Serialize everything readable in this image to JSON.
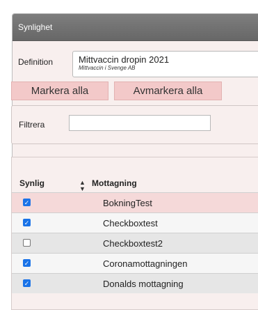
{
  "panel": {
    "title": "Synlighet"
  },
  "definition": {
    "label": "Definition",
    "selected_name": "Mittvaccin dropin 2021",
    "selected_org": "Mittvaccin i Svenge AB"
  },
  "buttons": {
    "select_all": "Markera alla",
    "deselect_all": "Avmarkera alla"
  },
  "filter": {
    "label": "Filtrera",
    "value": ""
  },
  "table": {
    "columns": {
      "visible": "Synlig",
      "reception": "Mottagning"
    },
    "rows": [
      {
        "checked": true,
        "name": "BokningTest",
        "bg": "#f5d9d9"
      },
      {
        "checked": true,
        "name": "Checkboxtest",
        "bg": "#f6f6f6"
      },
      {
        "checked": false,
        "name": "Checkboxtest2",
        "bg": "#e6e6e6"
      },
      {
        "checked": true,
        "name": "Coronamottagningen",
        "bg": "#f6f6f6"
      },
      {
        "checked": true,
        "name": "Donalds mottagning",
        "bg": "#e6e6e6"
      }
    ]
  },
  "icons": {
    "sort": "sort-updown-icon",
    "check": "check-icon"
  },
  "colors": {
    "checkbox_on": "#1a73e8",
    "button_bg": "#f3c9c9",
    "titlebar": "#6f6f6f"
  }
}
